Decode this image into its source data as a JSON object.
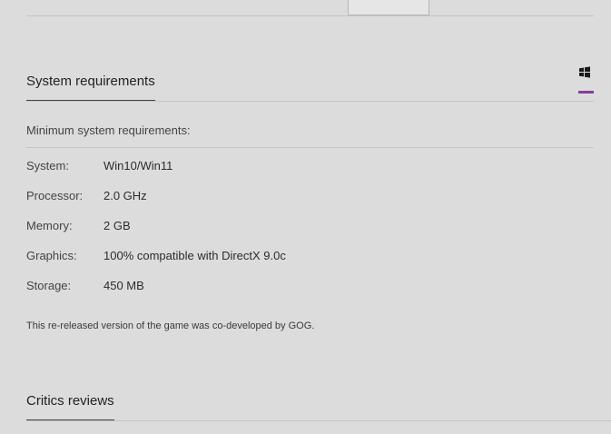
{
  "system_requirements": {
    "title": "System requirements",
    "os_tab_icon": "windows-icon",
    "accent_color": "#843f99",
    "min_label": "Minimum system requirements:",
    "rows": [
      {
        "key": "System:",
        "value": "Win10/Win11"
      },
      {
        "key": "Processor:",
        "value": "2.0 GHz"
      },
      {
        "key": "Memory:",
        "value": "2 GB"
      },
      {
        "key": "Graphics:",
        "value": "100% compatible with DirectX 9.0c"
      },
      {
        "key": "Storage:",
        "value": "450 MB"
      }
    ],
    "note": "This re-released version of the game was co-developed by GOG."
  },
  "critics": {
    "title": "Critics reviews"
  }
}
